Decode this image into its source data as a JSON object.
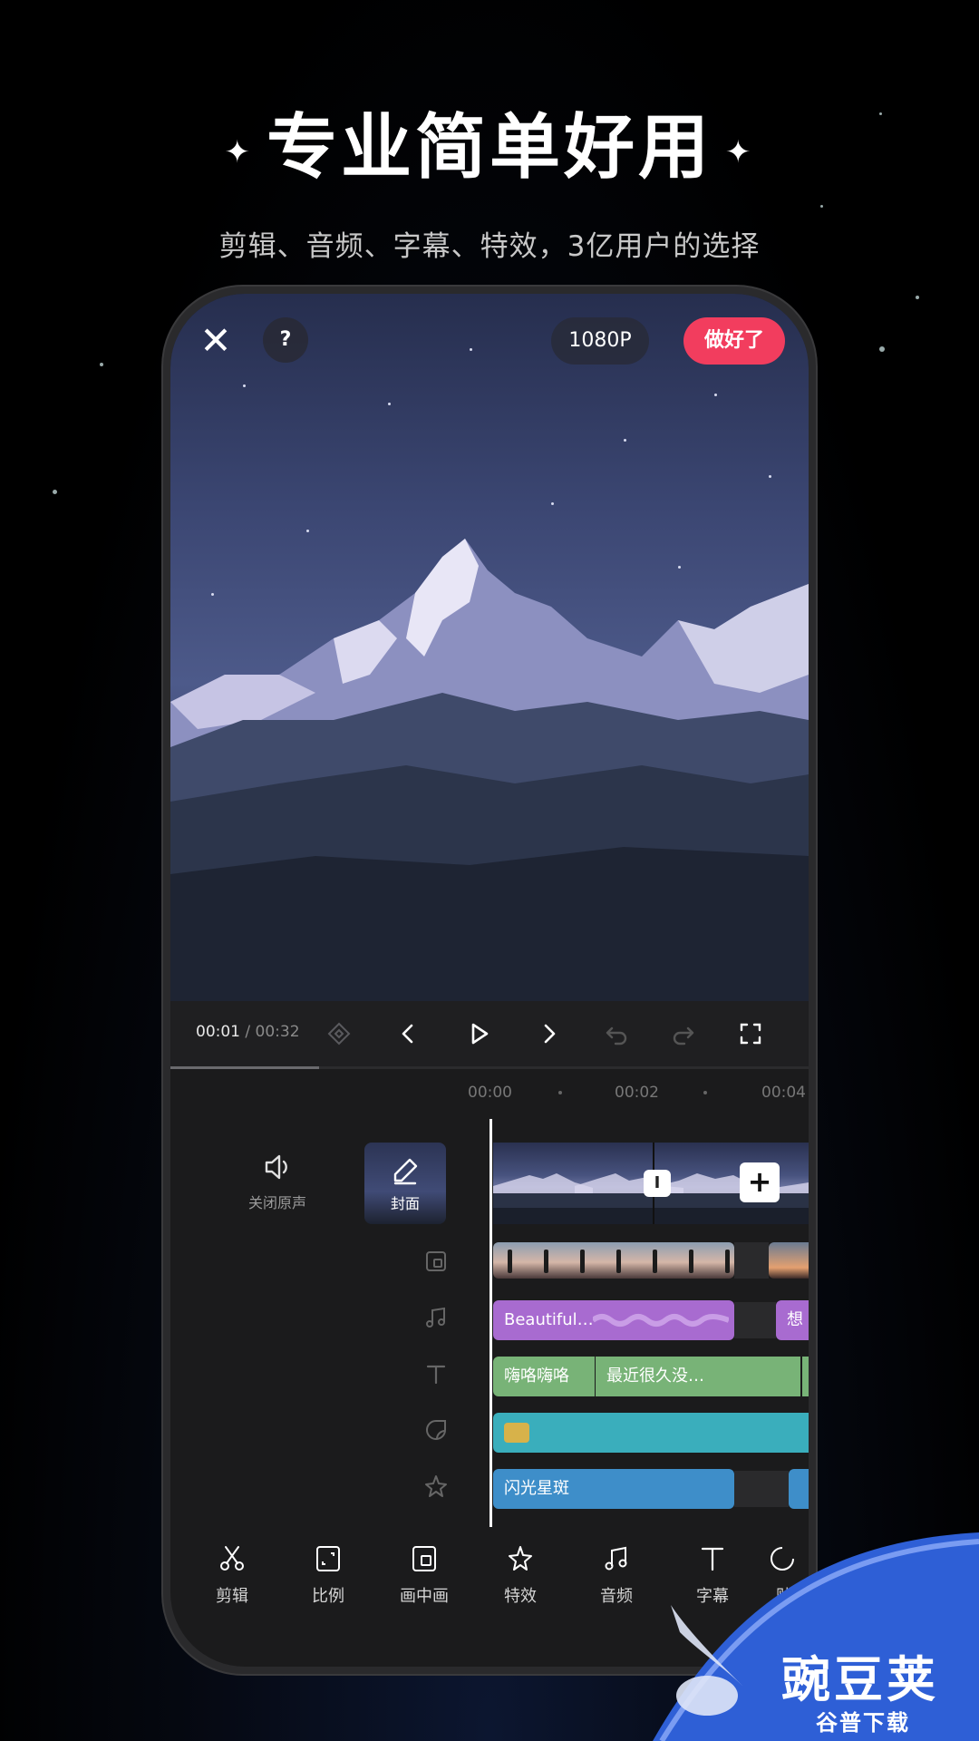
{
  "headline": {
    "spark_left": "✦",
    "title": "专业简单好用",
    "spark_right": "✦",
    "subtitle": "剪辑、音频、字幕、特效，3亿用户的选择"
  },
  "editor": {
    "top_bar": {
      "close_icon": "close-icon",
      "help_label": "?",
      "resolution_label": "1080P",
      "done_label": "做好了"
    },
    "playback": {
      "current_time": "00:01",
      "separator": "/",
      "total_time": "00:32",
      "progress_fraction": 0.03
    },
    "ruler": {
      "ticks": [
        "00:00",
        "00:02",
        "00:04"
      ]
    },
    "main_track": {
      "mute_label": "关闭原声",
      "cover_label": "封面",
      "transition_label": "I",
      "add_label": "+"
    },
    "tracks": {
      "music_clip_1": "Beautiful…",
      "music_clip_2": "想",
      "text_clip_1": "嗨咯嗨咯",
      "text_clip_2": "最近很久没…",
      "effect_clip_1": "闪光星斑"
    },
    "toolbar": [
      {
        "label": "剪辑",
        "icon": "scissors-icon"
      },
      {
        "label": "比例",
        "icon": "ratio-icon"
      },
      {
        "label": "画中画",
        "icon": "pip-icon"
      },
      {
        "label": "特效",
        "icon": "effects-star-icon"
      },
      {
        "label": "音频",
        "icon": "music-note-icon"
      },
      {
        "label": "字幕",
        "icon": "text-icon"
      },
      {
        "label": "贴",
        "icon": "sticker-icon"
      }
    ]
  },
  "watermark": {
    "brand": "豌豆荚",
    "sub": "谷普下载"
  },
  "colors": {
    "done_button": "#f23d5e",
    "music_track": "#a86bd0",
    "text_track": "#78b377",
    "sticker_track": "#3aaebc",
    "effect_track": "#3e8ec9",
    "watermark_blue": "#2e5fd6"
  }
}
